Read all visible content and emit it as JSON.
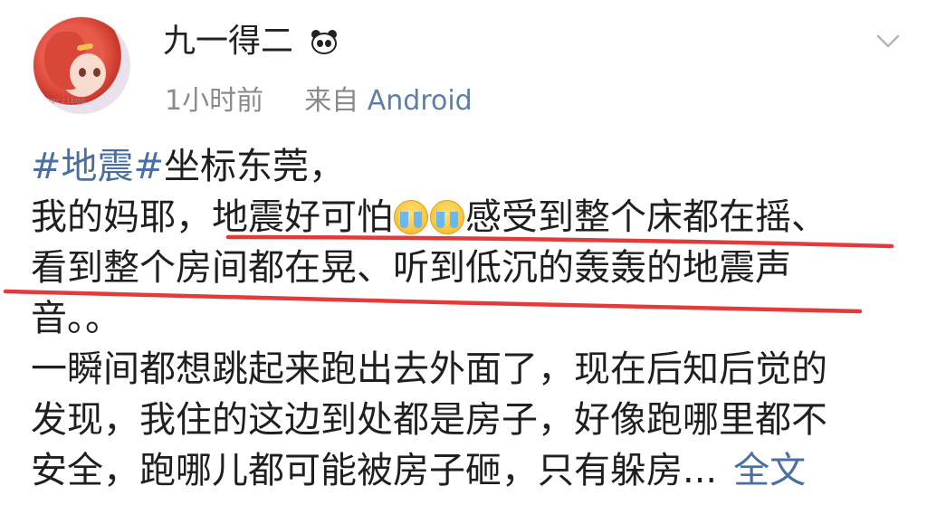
{
  "user": {
    "name": "九一得二",
    "time": "1小时前",
    "source_prefix": "来自",
    "source": "Android"
  },
  "post": {
    "tag": "#地震#",
    "line1_rest": "坐标东莞，",
    "line2_a": "我的妈耶，",
    "line2_b": "地震好可怕",
    "line2_c": "感受到整个床都在摇、",
    "line3": "看到整个房间都在晃、听到低沉的轰轰的地震声",
    "line4": "音。。",
    "line5": "一瞬间都想跳起来跑出去外面了，现在后知后觉的",
    "line6": "发现，我住的这边到处都是房子，好像跑哪里都不",
    "line7": "安全，跑哪儿都可能被房子砸，只有躲房...",
    "more": "全文"
  },
  "colors": {
    "link": "#4a6fa0",
    "underline": "#e33b3b",
    "meta": "#8a8a8a"
  },
  "icons": {
    "emoji": "crying-face-icon",
    "badge": "panda-icon",
    "menu": "chevron-down-icon"
  }
}
